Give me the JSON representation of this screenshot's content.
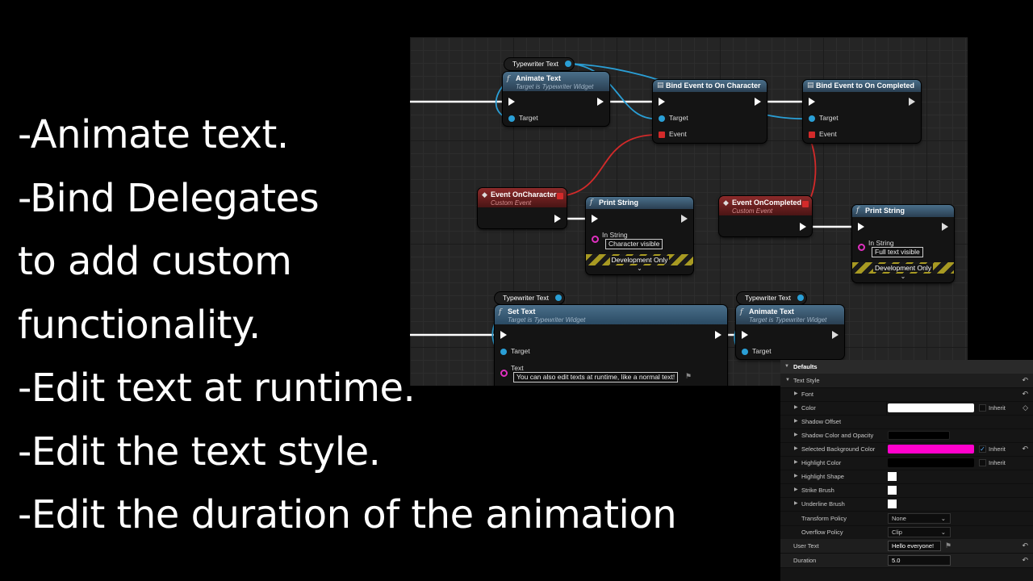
{
  "bullets": [
    "-Animate text.",
    "-Bind Delegates",
    "to add custom",
    "functionality.",
    "-Edit text at runtime.",
    "-Edit the text style.",
    "-Edit the duration of the animation"
  ],
  "colors": {
    "exec_wire": "#ffffff",
    "object_wire": "#2a9fd6",
    "delegate_wire": "#d32a2a",
    "string_pin": "#e030c0",
    "selected_bg_color": "#ff00cc"
  },
  "graph": {
    "var_typewriter_1": "Typewriter Text",
    "var_typewriter_2": "Typewriter Text",
    "var_typewriter_3": "Typewriter Text",
    "animate_text_1": {
      "title": "Animate Text",
      "subtitle": "Target is Typewriter Widget",
      "target": "Target"
    },
    "bind_character": {
      "title": "Bind Event to On Character",
      "target": "Target",
      "event": "Event"
    },
    "bind_completed": {
      "title": "Bind Event to On Completed",
      "target": "Target",
      "event": "Event"
    },
    "event_character": {
      "title": "Event OnCharacter",
      "subtitle": "Custom Event"
    },
    "print_1": {
      "title": "Print String",
      "in_string": "In String",
      "value": "Character visible",
      "dev": "Development Only"
    },
    "event_completed": {
      "title": "Event OnCompleted",
      "subtitle": "Custom Event"
    },
    "print_2": {
      "title": "Print String",
      "in_string": "In String",
      "value": "Full text visible",
      "dev": "Development Only"
    },
    "set_text": {
      "title": "Set Text",
      "subtitle": "Target is Typewriter Widget",
      "target": "Target",
      "text": "Text",
      "value": "You can also edit texts at runtime, like a normal text!"
    },
    "animate_text_2": {
      "title": "Animate Text",
      "subtitle": "Target is Typewriter Widget",
      "target": "Target"
    }
  },
  "details": {
    "defaults": "Defaults",
    "text_style": "Text Style",
    "font": "Font",
    "color": "Color",
    "shadow_offset": "Shadow Offset",
    "shadow_color": "Shadow Color and Opacity",
    "selected_bg": "Selected Background Color",
    "highlight_color": "Highlight Color",
    "highlight_shape": "Highlight Shape",
    "strike_brush": "Strike Brush",
    "underline_brush": "Underline Brush",
    "transform_policy": "Transform Policy",
    "transform_value": "None",
    "overflow_policy": "Overflow Policy",
    "overflow_value": "Clip",
    "user_text": "User Text",
    "user_text_value": "Hello everyone!",
    "duration": "Duration",
    "duration_value": "5.0",
    "inherit": "Inherit",
    "selected_bg_inherit_checked": true
  }
}
